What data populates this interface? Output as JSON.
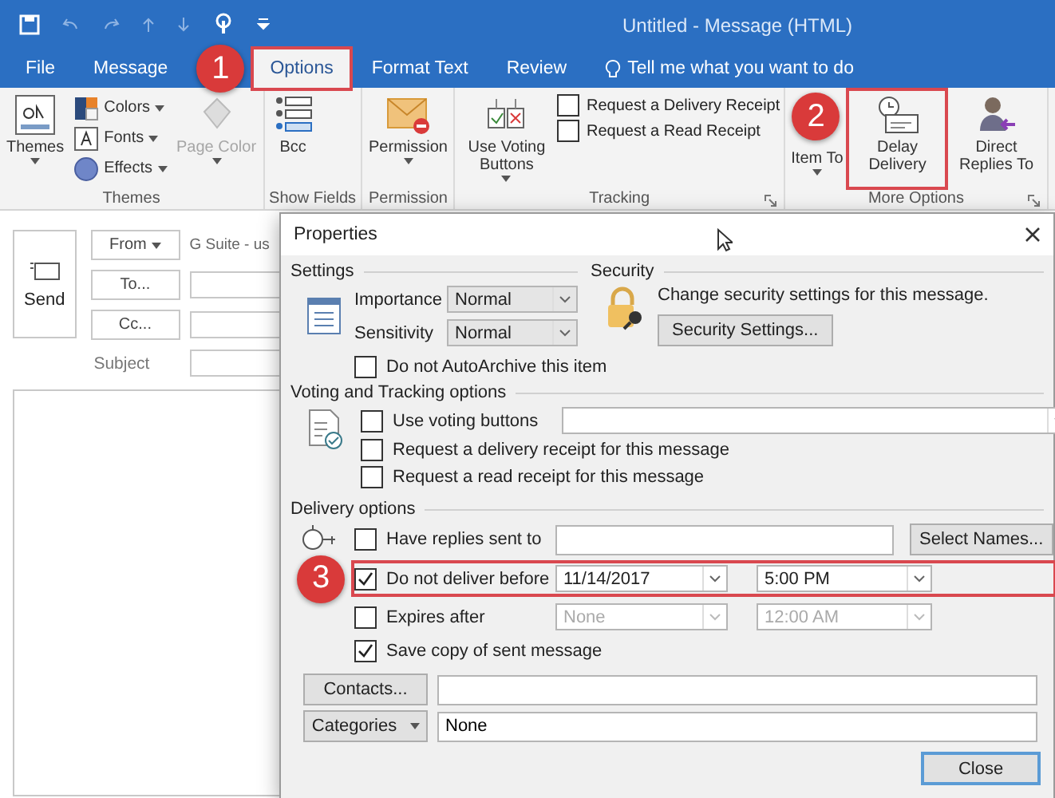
{
  "window": {
    "title": "Untitled - Message (HTML)"
  },
  "tabs": [
    {
      "label": "File",
      "selected": false
    },
    {
      "label": "Message",
      "selected": false
    },
    {
      "label": "Options",
      "selected": true,
      "callout": "1"
    },
    {
      "label": "Format Text",
      "selected": false
    },
    {
      "label": "Review",
      "selected": false
    }
  ],
  "tell_me": "Tell me what you want to do",
  "ribbon": {
    "groups": [
      {
        "label": "Themes",
        "items": [
          {
            "kind": "large",
            "label": "Themes",
            "dropdown": true,
            "disabled": false
          },
          {
            "kind": "small",
            "label": "Colors",
            "dropdown": true,
            "disabled": false
          },
          {
            "kind": "small",
            "label": "Fonts",
            "dropdown": true,
            "disabled": false
          },
          {
            "kind": "small",
            "label": "Effects",
            "dropdown": true,
            "disabled": false
          },
          {
            "kind": "large",
            "label": "Page Color",
            "dropdown": true,
            "disabled": true
          }
        ]
      },
      {
        "label": "Show Fields",
        "items": [
          {
            "kind": "large",
            "label": "Bcc",
            "disabled": false
          }
        ]
      },
      {
        "label": "Permission",
        "items": [
          {
            "kind": "large",
            "label": "Permission",
            "dropdown": true,
            "disabled": false
          }
        ]
      },
      {
        "label": "Tracking",
        "launcher": true,
        "items": [
          {
            "kind": "large",
            "label": "Use Voting Buttons",
            "dropdown": true,
            "disabled": false
          },
          {
            "kind": "check",
            "label": "Request a Delivery Receipt",
            "checked": false
          },
          {
            "kind": "check",
            "label": "Request a Read Receipt",
            "checked": false
          }
        ]
      },
      {
        "label": "More Options",
        "launcher": true,
        "items": [
          {
            "kind": "large",
            "label": "Item To",
            "dropdown": true,
            "disabled": false
          },
          {
            "kind": "large",
            "label": "Delay Delivery",
            "disabled": false,
            "callout": "2"
          },
          {
            "kind": "large",
            "label": "Direct Replies To",
            "disabled": false
          }
        ]
      }
    ]
  },
  "compose": {
    "send": "Send",
    "from_button": "From",
    "from_value": "G Suite - us",
    "to_button": "To...",
    "cc_button": "Cc...",
    "subject_label": "Subject"
  },
  "dialog": {
    "title": "Properties",
    "settings": {
      "label": "Settings",
      "importance_label": "Importance",
      "importance": "Normal",
      "sensitivity_label": "Sensitivity",
      "sensitivity": "Normal",
      "autoarchive": {
        "label": "Do not AutoArchive this item",
        "checked": false
      }
    },
    "security": {
      "label": "Security",
      "text": "Change security settings for this message.",
      "button": "Security Settings..."
    },
    "voting": {
      "label": "Voting and Tracking options",
      "options": [
        {
          "label": "Use voting buttons",
          "checked": false
        },
        {
          "label": "Request a delivery receipt for this message",
          "checked": false
        },
        {
          "label": "Request a read receipt for this message",
          "checked": false
        }
      ]
    },
    "delivery": {
      "label": "Delivery options",
      "rows": [
        {
          "kind": "replies",
          "label": "Have replies sent to",
          "checked": false,
          "button": "Select Names..."
        },
        {
          "kind": "datetime",
          "label": "Do not deliver before",
          "checked": true,
          "disabled": false,
          "date": "11/14/2017",
          "time": "5:00 PM",
          "callout": "3"
        },
        {
          "kind": "datetime",
          "label": "Expires after",
          "checked": false,
          "disabled": true,
          "date": "None",
          "time": "12:00 AM"
        },
        {
          "kind": "check",
          "label": "Save copy of sent message",
          "checked": true
        }
      ]
    },
    "contacts_button": "Contacts...",
    "categories_button": "Categories",
    "categories_value": "None",
    "close_button": "Close"
  }
}
